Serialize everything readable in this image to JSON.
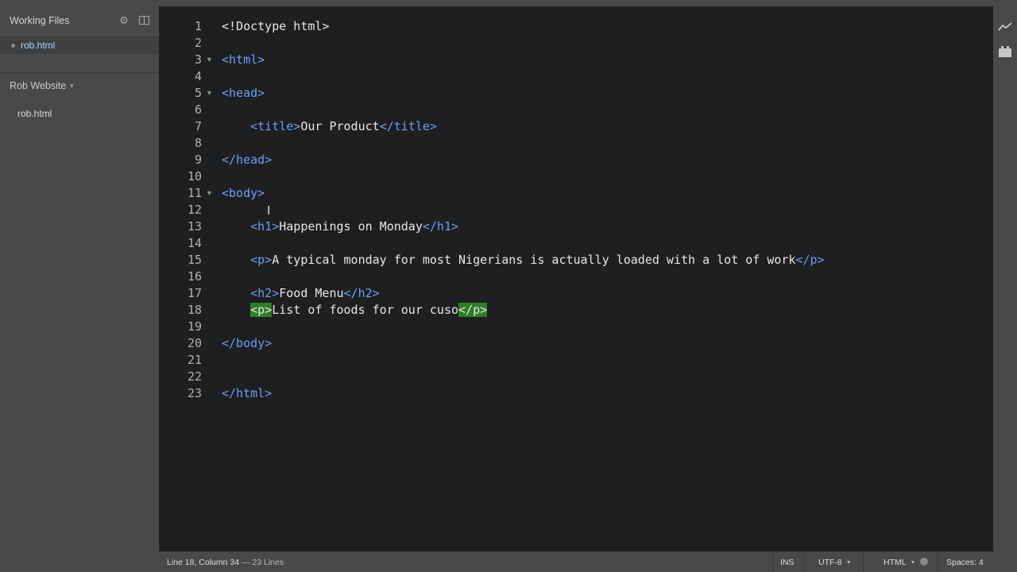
{
  "sidebar": {
    "working_files_title": "Working Files",
    "working_file": "rob.html",
    "project_title": "Rob Website",
    "project_caret": "▼",
    "project_file": "rob.html"
  },
  "editor": {
    "lines": [
      {
        "num": "1",
        "fold": "",
        "indent": "",
        "parts": [
          {
            "t": "<!Doctype html>",
            "c": "tagtext"
          }
        ]
      },
      {
        "num": "2",
        "fold": "",
        "indent": "",
        "parts": []
      },
      {
        "num": "3",
        "fold": "▼",
        "indent": "",
        "parts": [
          {
            "t": "<html>",
            "c": "tag"
          }
        ]
      },
      {
        "num": "4",
        "fold": "",
        "indent": "",
        "parts": []
      },
      {
        "num": "5",
        "fold": "▼",
        "indent": "",
        "parts": [
          {
            "t": "<head>",
            "c": "tag"
          }
        ]
      },
      {
        "num": "6",
        "fold": "",
        "indent": "",
        "parts": []
      },
      {
        "num": "7",
        "fold": "",
        "indent": "    ",
        "parts": [
          {
            "t": "<title>",
            "c": "tag"
          },
          {
            "t": "Our Product",
            "c": "tagtext"
          },
          {
            "t": "</title>",
            "c": "tag"
          }
        ]
      },
      {
        "num": "8",
        "fold": "",
        "indent": "",
        "parts": []
      },
      {
        "num": "9",
        "fold": "",
        "indent": "",
        "parts": [
          {
            "t": "</head>",
            "c": "tag"
          }
        ]
      },
      {
        "num": "10",
        "fold": "",
        "indent": "",
        "parts": []
      },
      {
        "num": "11",
        "fold": "▼",
        "indent": "",
        "parts": [
          {
            "t": "<body>",
            "c": "tag"
          }
        ]
      },
      {
        "num": "12",
        "fold": "",
        "indent": "",
        "parts": []
      },
      {
        "num": "13",
        "fold": "",
        "indent": "    ",
        "parts": [
          {
            "t": "<h1>",
            "c": "tag"
          },
          {
            "t": "Happenings on Monday",
            "c": "tagtext"
          },
          {
            "t": "</h1>",
            "c": "tag"
          }
        ]
      },
      {
        "num": "14",
        "fold": "",
        "indent": "",
        "parts": []
      },
      {
        "num": "15",
        "fold": "",
        "indent": "    ",
        "parts": [
          {
            "t": "<p>",
            "c": "tag"
          },
          {
            "t": "A typical monday for most Nigerians is actually loaded with a lot of work",
            "c": "tagtext"
          },
          {
            "t": "</p>",
            "c": "tag"
          }
        ]
      },
      {
        "num": "16",
        "fold": "",
        "indent": "",
        "parts": []
      },
      {
        "num": "17",
        "fold": "",
        "indent": "    ",
        "parts": [
          {
            "t": "<h2>",
            "c": "tag"
          },
          {
            "t": "Food Menu",
            "c": "tagtext"
          },
          {
            "t": "</h2>",
            "c": "tag"
          }
        ]
      },
      {
        "num": "18",
        "fold": "",
        "indent": "    ",
        "parts": [
          {
            "t": "<p>",
            "c": "hl"
          },
          {
            "t": "List of foods for our cuso",
            "c": "tagtext"
          },
          {
            "t": "</p>",
            "c": "hl"
          }
        ]
      },
      {
        "num": "19",
        "fold": "",
        "indent": "",
        "parts": []
      },
      {
        "num": "20",
        "fold": "",
        "indent": "",
        "parts": [
          {
            "t": "</body>",
            "c": "tag"
          }
        ]
      },
      {
        "num": "21",
        "fold": "",
        "indent": "",
        "parts": []
      },
      {
        "num": "22",
        "fold": "",
        "indent": "",
        "parts": []
      },
      {
        "num": "23",
        "fold": "",
        "indent": "",
        "parts": [
          {
            "t": "</html>",
            "c": "tag"
          }
        ]
      }
    ]
  },
  "statusbar": {
    "position": "Line 18, Column 34",
    "lines": " — 23 Lines",
    "mode": "INS",
    "encoding": "UTF-8",
    "language": "HTML",
    "spaces": "Spaces: 4",
    "caret": "▼"
  },
  "icons": {
    "settings": "gear-icon",
    "split": "split-view-icon",
    "live_preview": "live-preview-icon",
    "extensions": "extension-manager-icon",
    "lint": "lint-status-icon"
  },
  "colors": {
    "sidebar_bg": "#47494b",
    "editor_bg": "#1d1f21",
    "tag": "#6c9ef8",
    "text": "#e6e6e6",
    "match_highlight": "#2f7d24",
    "active_file": "#a6d8ff"
  }
}
